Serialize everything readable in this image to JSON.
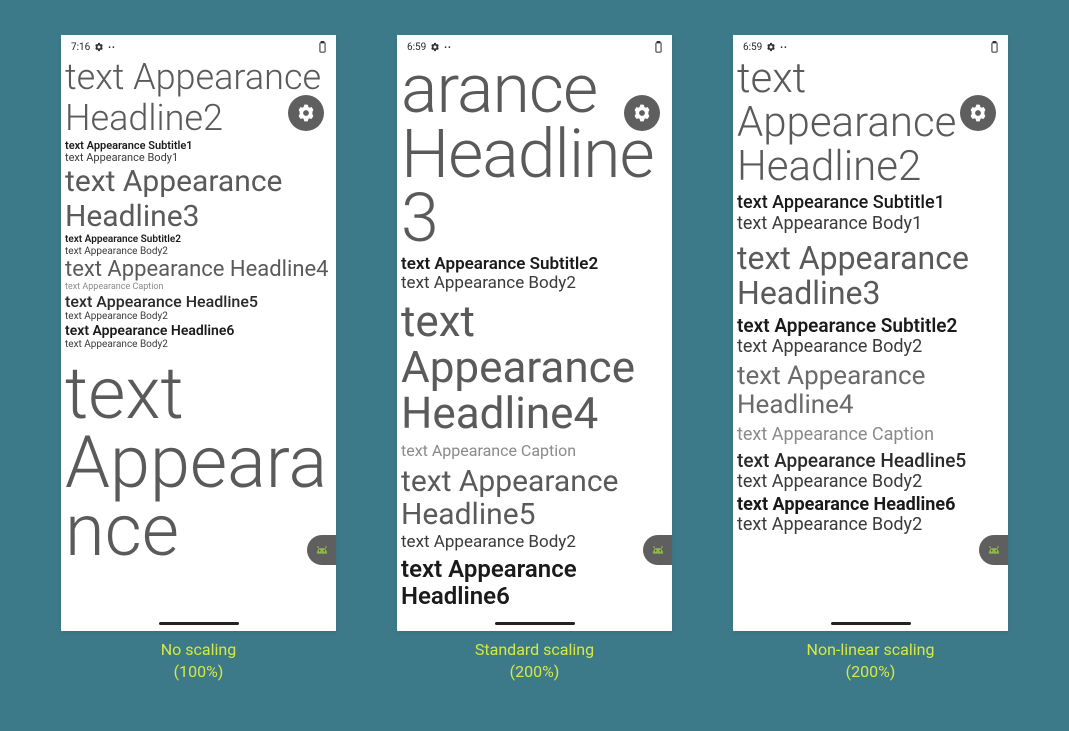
{
  "screens": [
    {
      "time": "7:16",
      "caption_line1": "No scaling",
      "caption_line2": "(100%)",
      "lines": {
        "headline2": "text Appearance Headline2",
        "subtitle1": "text Appearance Subtitle1",
        "body1": "text Appearance Body1",
        "headline3": "text Appearance Headline3",
        "subtitle2": "text Appearance Subtitle2",
        "body2a": "text Appearance Body2",
        "headline4": "text Appearance Headline4",
        "caption": "text Appearance Caption",
        "headline5": "text Appearance Headline5",
        "body2b": "text Appearance Body2",
        "headline6": "text Appearance Headline6",
        "body2c": "text Appearance Body2",
        "huge": "text Appearance"
      }
    },
    {
      "time": "6:59",
      "caption_line1": "Standard scaling",
      "caption_line2": "(200%)",
      "lines": {
        "headline3": "arance Headline3",
        "subtitle2": "text Appearance Subtitle2",
        "body2a": "text Appearance Body2",
        "headline4": "text Appearance Headline4",
        "caption": "text Appearance Caption",
        "headline5": "text Appearance Headline5",
        "body2b": "text Appearance Body2",
        "headline6": "text Appearance Headline6"
      }
    },
    {
      "time": "6:59",
      "caption_line1": "Non-linear scaling",
      "caption_line2": "(200%)",
      "lines": {
        "headline2": "text Appearance Headline2",
        "subtitle1": "text Appearance Subtitle1",
        "body1": "text Appearance Body1",
        "headline3": "text Appearance Headline3",
        "subtitle2": "text Appearance Subtitle2",
        "body2a": "text Appearance Body2",
        "headline4": "text Appearance Headline4",
        "caption": "text Appearance Caption",
        "headline5": "text Appearance Headline5",
        "body2b": "text Appearance Body2",
        "headline6": "text Appearance Headline6",
        "body2c": "text Appearance Body2"
      }
    }
  ]
}
